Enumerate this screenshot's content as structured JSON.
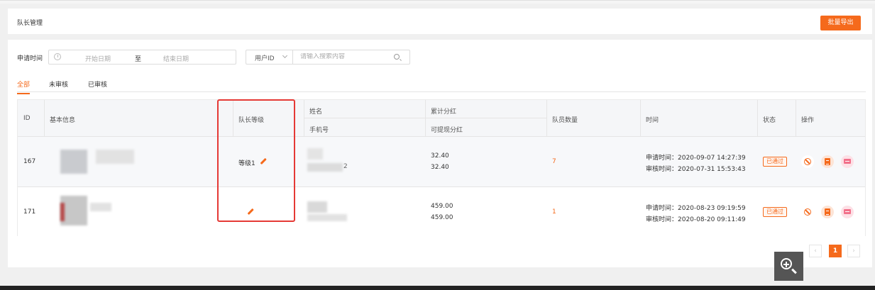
{
  "header": {
    "title": "队长管理",
    "export_label": "批量导出"
  },
  "filters": {
    "time_label": "申请时间",
    "start_placeholder": "开始日期",
    "separator": "至",
    "end_placeholder": "结束日期",
    "field_select": "用户ID",
    "search_placeholder": "请输入搜索内容"
  },
  "tabs": [
    {
      "label": "全部",
      "active": true
    },
    {
      "label": "未审核",
      "active": false
    },
    {
      "label": "已审核",
      "active": false
    }
  ],
  "table": {
    "headers": {
      "id": "ID",
      "basic_info": "基本信息",
      "level": "队长等级",
      "name": "姓名",
      "phone": "手机号",
      "total_dividend": "累计分红",
      "withdrawable": "可提现分红",
      "member_count": "队员数量",
      "time": "时间",
      "status": "状态",
      "actions": "操作"
    },
    "rows": [
      {
        "id": "167",
        "level": "等级1",
        "phone_tail": "2",
        "total_dividend": "32.40",
        "withdrawable": "32.40",
        "member_count": "7",
        "apply_time": "申请时间：2020-09-07 14:27:39",
        "review_time": "审核时间：2020-07-31 15:53:43",
        "status": "已通过"
      },
      {
        "id": "171",
        "level": "",
        "phone_tail": "",
        "total_dividend": "459.00",
        "withdrawable": "459.00",
        "member_count": "1",
        "apply_time": "申请时间：2020-08-23 09:19:59",
        "review_time": "审核时间：2020-08-20 09:11:49",
        "status": "已通过"
      }
    ]
  },
  "pagination": {
    "current": "1",
    "prev": "‹",
    "next": "›"
  },
  "colors": {
    "accent": "#f56a1c",
    "highlight": "#e53935"
  },
  "icons": [
    "clock-icon",
    "search-icon",
    "edit-icon",
    "ban-icon",
    "clipboard-icon",
    "message-icon",
    "zoom-in-icon"
  ]
}
